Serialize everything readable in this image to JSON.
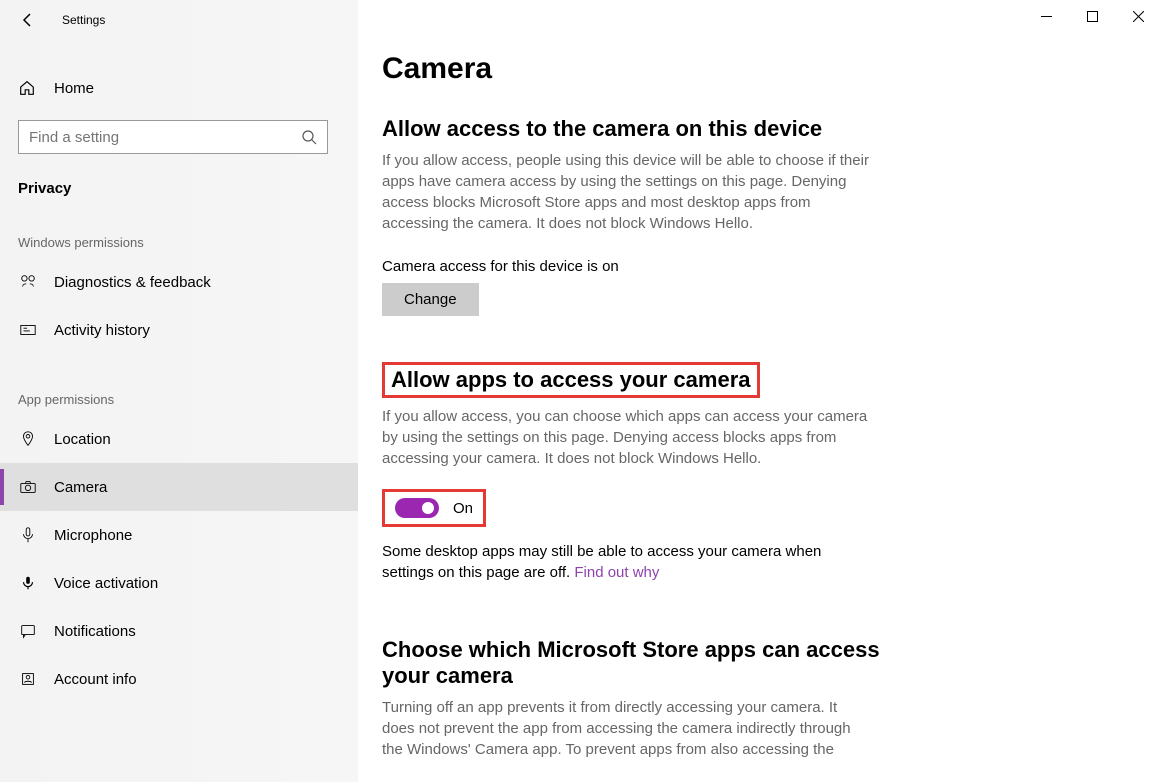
{
  "titlebar": {
    "title": "Settings"
  },
  "sidebar": {
    "home_label": "Home",
    "search_placeholder": "Find a setting",
    "category": "Privacy",
    "section1_title": "Windows permissions",
    "section1_items": [
      {
        "icon": "diagnostics",
        "label": "Diagnostics & feedback"
      },
      {
        "icon": "activity",
        "label": "Activity history"
      }
    ],
    "section2_title": "App permissions",
    "section2_items": [
      {
        "icon": "location",
        "label": "Location",
        "selected": false
      },
      {
        "icon": "camera",
        "label": "Camera",
        "selected": true
      },
      {
        "icon": "microphone",
        "label": "Microphone",
        "selected": false
      },
      {
        "icon": "voice",
        "label": "Voice activation",
        "selected": false
      },
      {
        "icon": "notifications",
        "label": "Notifications",
        "selected": false
      },
      {
        "icon": "account",
        "label": "Account info",
        "selected": false
      }
    ]
  },
  "main": {
    "page_title": "Camera",
    "section1": {
      "heading": "Allow access to the camera on this device",
      "description": "If you allow access, people using this device will be able to choose if their apps have camera access by using the settings on this page. Denying access blocks Microsoft Store apps and most desktop apps from accessing the camera. It does not block Windows Hello.",
      "status": "Camera access for this device is on",
      "change_button": "Change"
    },
    "section2": {
      "heading": "Allow apps to access your camera",
      "description": "If you allow access, you can choose which apps can access your camera by using the settings on this page. Denying access blocks apps from accessing your camera. It does not block Windows Hello.",
      "toggle_state": "On",
      "note_prefix": "Some desktop apps may still be able to access your camera when settings on this page are off. ",
      "note_link": "Find out why"
    },
    "section3": {
      "heading": "Choose which Microsoft Store apps can access your camera",
      "description": "Turning off an app prevents it from directly accessing your camera. It does not prevent the app from accessing the camera indirectly through the Windows' Camera app. To prevent apps from also accessing the"
    }
  },
  "annotations": {
    "highlight_section2_heading": true,
    "highlight_toggle": true
  }
}
